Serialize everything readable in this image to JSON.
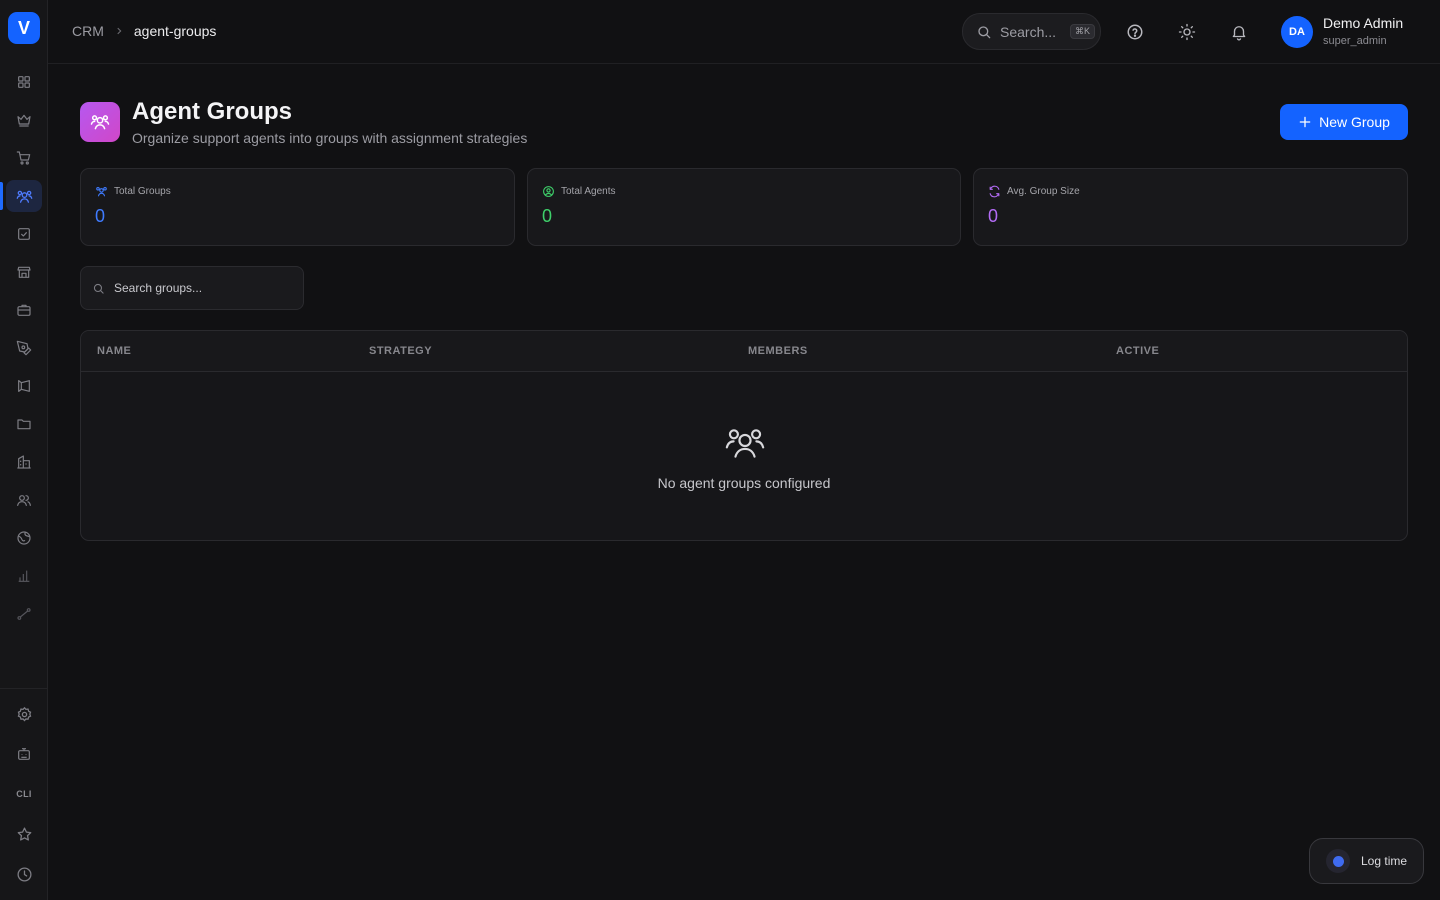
{
  "app": {
    "logo_letter": "V",
    "accent": "#1463ff"
  },
  "breadcrumb": {
    "root": "CRM",
    "separator": ">",
    "current": "agent-groups"
  },
  "header": {
    "search_label": "Search...",
    "search_shortcut": "⌘K",
    "icons": [
      "help-icon",
      "sun-icon",
      "bell-icon"
    ]
  },
  "user": {
    "initials": "DA",
    "name": "Demo Admin",
    "role": "super_admin"
  },
  "sidebar": {
    "active_item": "agent-groups",
    "items": [
      {
        "name": "dashboard-grid",
        "icon": "grid-icon"
      },
      {
        "name": "crown",
        "icon": "crown-icon"
      },
      {
        "name": "cart",
        "icon": "cart-icon"
      },
      {
        "name": "agent-groups",
        "icon": "users-icon"
      },
      {
        "name": "tasks",
        "icon": "checkbox-icon"
      },
      {
        "name": "store",
        "icon": "store-icon"
      },
      {
        "name": "briefcase",
        "icon": "briefcase-icon"
      },
      {
        "name": "design",
        "icon": "pen-tool-icon"
      },
      {
        "name": "campaigns",
        "icon": "megaphone-icon"
      },
      {
        "name": "files",
        "icon": "folder-icon"
      },
      {
        "name": "buildings",
        "icon": "building-icon"
      },
      {
        "name": "contacts",
        "icon": "contacts-icon"
      },
      {
        "name": "globe",
        "icon": "globe-icon"
      },
      {
        "name": "analytics",
        "icon": "bar-chart-icon"
      },
      {
        "name": "route",
        "icon": "route-icon"
      }
    ],
    "bottom_items": [
      {
        "name": "settings",
        "icon": "gear-icon"
      },
      {
        "name": "assistant",
        "icon": "bot-icon"
      },
      {
        "name": "cli",
        "label": "CLI"
      },
      {
        "name": "favorites",
        "icon": "star-icon"
      },
      {
        "name": "history",
        "icon": "clock-icon"
      }
    ]
  },
  "page": {
    "title": "Agent Groups",
    "subtitle": "Organize support agents into groups with assignment strategies",
    "new_button": "New Group"
  },
  "stats": [
    {
      "label": "Total Groups",
      "value": "0",
      "color": "#3f7bff"
    },
    {
      "label": "Total Agents",
      "value": "0",
      "color": "#3ecf6a"
    },
    {
      "label": "Avg. Group Size",
      "value": "0",
      "color": "#b36bf5"
    }
  ],
  "filter": {
    "placeholder": "Search groups..."
  },
  "table": {
    "columns": [
      "NAME",
      "STRATEGY",
      "MEMBERS",
      "ACTIVE"
    ],
    "rows": [],
    "empty_text": "No agent groups configured"
  },
  "log_time": {
    "label": "Log time"
  }
}
